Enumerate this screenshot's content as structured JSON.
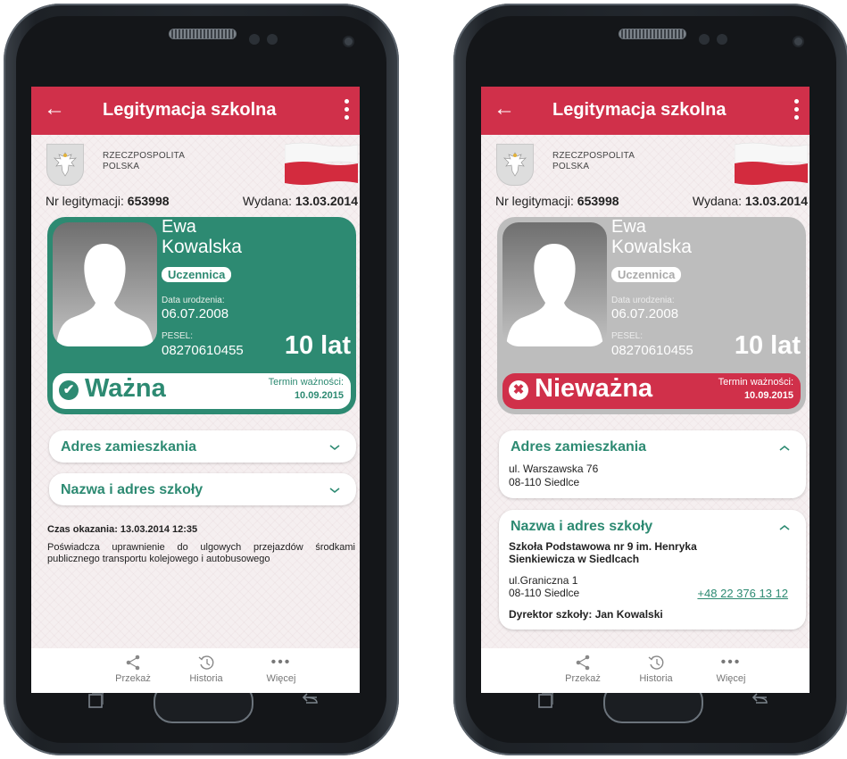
{
  "screens": [
    {
      "appbar": {
        "back": "←",
        "title": "Legitymacja szkolna",
        "menu_icon": "more-vertical-icon"
      },
      "header": {
        "country_line1": "RZECZPOSPOLITA",
        "country_line2": "POLSKA"
      },
      "ids": {
        "nr_label": "Nr legitymacji:",
        "nr_value": "653998",
        "issued_label": "Wydana:",
        "issued_value": "13.03.2014"
      },
      "card": {
        "first_name": "Ewa",
        "last_name": "Kowalska",
        "role": "Uczennica",
        "dob_label": "Data urodzenia:",
        "dob_value": "06.07.2008",
        "pesel_label": "PESEL:",
        "pesel_value": "08270610455",
        "age": "10 lat",
        "status_icon": "✔",
        "status": "Ważna",
        "expiry_label": "Termin ważności:",
        "expiry_value": "10.09.2015",
        "status_color": "#2d8a72"
      },
      "address_section": {
        "title": "Adres zamieszkania",
        "expanded": false
      },
      "school_section": {
        "title": "Nazwa i adres szkoły",
        "expanded": false
      },
      "shown_time": "Czas okazania: 13.03.2014 12:35",
      "description": "Poświadcza uprawnienie do ulgowych przejazdów środkami publicznego transportu kolejowego i autobusowego",
      "nav": [
        {
          "label": "Przekaż",
          "icon": "share-icon"
        },
        {
          "label": "Historia",
          "icon": "history-icon"
        },
        {
          "label": "Więcej",
          "icon": "more-horizontal-icon"
        }
      ]
    },
    {
      "appbar": {
        "back": "←",
        "title": "Legitymacja szkolna",
        "menu_icon": "more-vertical-icon"
      },
      "header": {
        "country_line1": "RZECZPOSPOLITA",
        "country_line2": "POLSKA"
      },
      "ids": {
        "nr_label": "Nr legitymacji:",
        "nr_value": "653998",
        "issued_label": "Wydana:",
        "issued_value": "13.03.2014"
      },
      "card": {
        "first_name": "Ewa",
        "last_name": "Kowalska",
        "role": "Uczennica",
        "dob_label": "Data urodzenia:",
        "dob_value": "06.07.2008",
        "pesel_label": "PESEL:",
        "pesel_value": "08270610455",
        "age": "10 lat",
        "status_icon": "✖",
        "status": "Nieważna",
        "expiry_label": "Termin ważności:",
        "expiry_value": "10.09.2015",
        "status_color": "#d0304a"
      },
      "address_section": {
        "title": "Adres zamieszkania",
        "expanded": true,
        "line1": "ul. Warszawska 76",
        "line2": "08-110 Siedlce"
      },
      "school_section": {
        "title": "Nazwa i adres szkoły",
        "expanded": true,
        "name_line1": "Szkoła Podstawowa nr 9 im. Henryka",
        "name_line2": "Sienkiewicza w Siedlcach",
        "street": "ul.Graniczna 1",
        "city": "08-110 Siedlce",
        "phone": "+48 22 376 13 12",
        "director": "Dyrektor szkoły: Jan Kowalski"
      },
      "nav": [
        {
          "label": "Przekaż",
          "icon": "share-icon"
        },
        {
          "label": "Historia",
          "icon": "history-icon"
        },
        {
          "label": "Więcej",
          "icon": "more-horizontal-icon"
        }
      ]
    }
  ],
  "colors": {
    "brand_red": "#d0304a",
    "valid_green": "#2d8a72",
    "invalid_gray": "#bdbdbd"
  }
}
